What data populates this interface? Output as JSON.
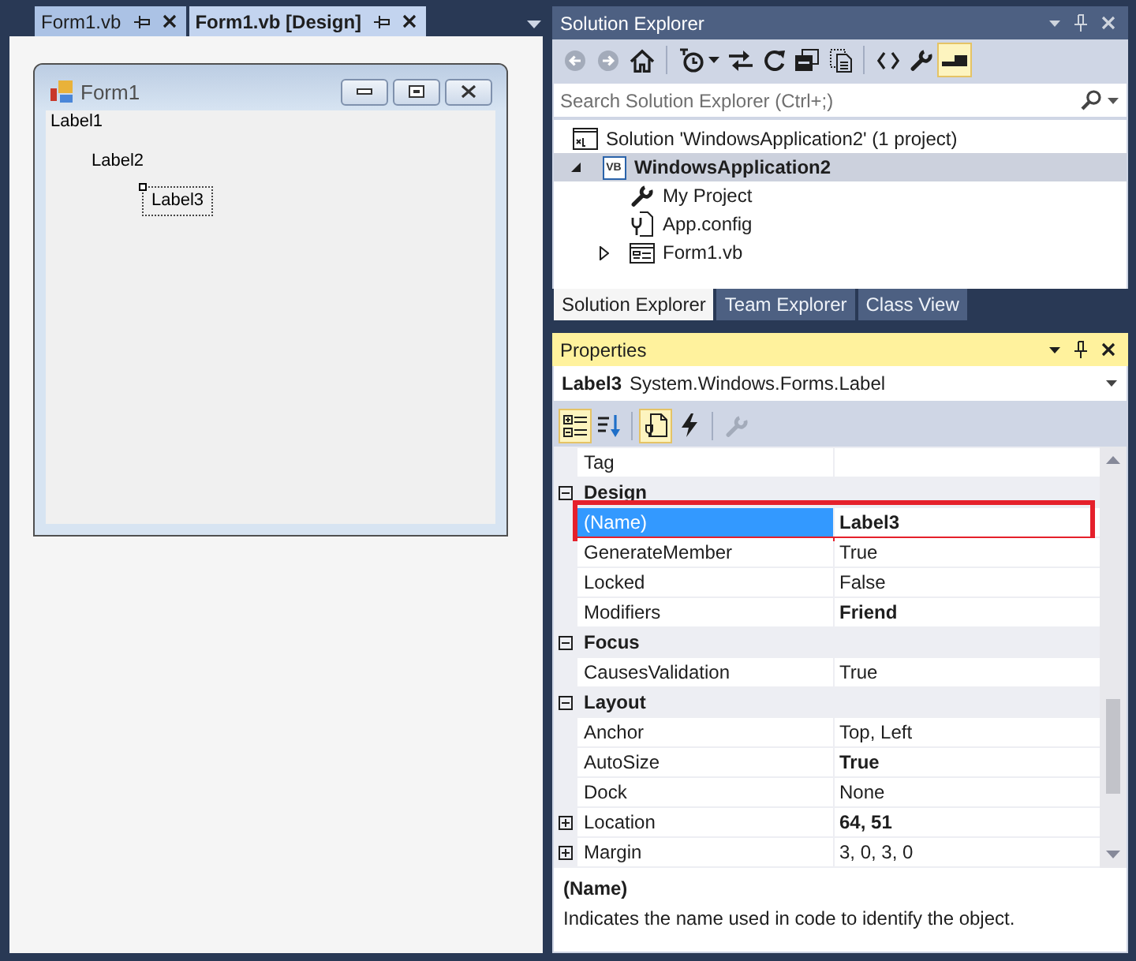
{
  "document_tabs": [
    {
      "label": "Form1.vb",
      "selected": false
    },
    {
      "label": "Form1.vb [Design]",
      "selected": true
    }
  ],
  "designer": {
    "form": {
      "title": "Form1",
      "labels": [
        {
          "text": "Label1",
          "selected": false
        },
        {
          "text": "Label2",
          "selected": false
        },
        {
          "text": "Label3",
          "selected": true
        }
      ]
    }
  },
  "solution_explorer": {
    "title": "Solution Explorer",
    "active": false,
    "toolbar_groups": [
      [
        {
          "kind": "back",
          "disabled": true,
          "selected": false
        },
        {
          "kind": "forward",
          "disabled": true,
          "selected": false
        },
        {
          "kind": "home",
          "disabled": false,
          "selected": false
        }
      ],
      [
        {
          "kind": "history",
          "disabled": false,
          "selected": false
        },
        {
          "kind": "sync",
          "disabled": false,
          "selected": false
        },
        {
          "kind": "refresh",
          "disabled": false,
          "selected": false
        },
        {
          "kind": "collapse-all",
          "disabled": false,
          "selected": false
        },
        {
          "kind": "show-all-files",
          "disabled": false,
          "selected": false
        }
      ],
      [
        {
          "kind": "view-code",
          "disabled": false,
          "selected": false
        },
        {
          "kind": "properties",
          "disabled": false,
          "selected": false
        },
        {
          "kind": "preview",
          "disabled": false,
          "selected": true
        }
      ]
    ],
    "search": {
      "placeholder": "Search Solution Explorer (Ctrl+;)"
    },
    "tree": [
      {
        "label": "Solution 'WindowsApplication2' (1 project)",
        "kind": "solution",
        "selected": false,
        "children": [
          {
            "label": "WindowsApplication2",
            "kind": "project",
            "badge": "VB",
            "selected": true,
            "startup": true,
            "expanded": true,
            "children": [
              {
                "label": "My Project",
                "kind": "settings",
                "selected": false
              },
              {
                "label": "App.config",
                "kind": "config",
                "selected": false
              },
              {
                "label": "Form1.vb",
                "kind": "form",
                "selected": false,
                "expanded": false
              }
            ]
          }
        ]
      }
    ],
    "bottom_tabs": [
      {
        "label": "Solution Explorer",
        "selected": true
      },
      {
        "label": "Team Explorer",
        "selected": false
      },
      {
        "label": "Class View",
        "selected": false
      }
    ]
  },
  "properties": {
    "title": "Properties",
    "active": true,
    "object": {
      "name": "Label3",
      "type": "System.Windows.Forms.Label"
    },
    "toolbar_groups": [
      [
        {
          "kind": "categorized",
          "disabled": false,
          "selected": true
        },
        {
          "kind": "alphabetical",
          "disabled": false,
          "selected": false
        }
      ],
      [
        {
          "kind": "property-view",
          "disabled": false,
          "selected": true
        },
        {
          "kind": "events",
          "disabled": false,
          "selected": false
        }
      ],
      [
        {
          "kind": "property-pages",
          "disabled": true,
          "selected": false
        }
      ]
    ],
    "sections": [
      {
        "properties": [
          {
            "name": "Tag",
            "selected": false
          }
        ]
      },
      {
        "category": "Design",
        "expanded": true,
        "properties": [
          {
            "name": "(Name)",
            "value": "Label3",
            "selected": true,
            "modified": true,
            "outlined": true
          },
          {
            "name": "GenerateMember",
            "value": "True",
            "selected": false,
            "modified": false
          },
          {
            "name": "Locked",
            "value": "False",
            "selected": false,
            "modified": false
          },
          {
            "name": "Modifiers",
            "value": "Friend",
            "selected": false,
            "modified": true
          }
        ]
      },
      {
        "category": "Focus",
        "expanded": true,
        "properties": [
          {
            "name": "CausesValidation",
            "value": "True",
            "selected": false,
            "modified": false
          }
        ]
      },
      {
        "category": "Layout",
        "expanded": true,
        "properties": [
          {
            "name": "Anchor",
            "value": "Top, Left",
            "selected": false,
            "modified": false
          },
          {
            "name": "AutoSize",
            "value": "True",
            "selected": false,
            "modified": true
          },
          {
            "name": "Dock",
            "value": "None",
            "selected": false,
            "modified": false
          },
          {
            "name": "Location",
            "value": "64, 51",
            "selected": false,
            "modified": true,
            "expanded": false
          },
          {
            "name": "Margin",
            "value": "3, 0, 3, 0",
            "selected": false,
            "modified": false,
            "expanded": false
          }
        ]
      }
    ],
    "description": {
      "title": "(Name)",
      "text": "Indicates the name used in code to identify the object."
    }
  }
}
